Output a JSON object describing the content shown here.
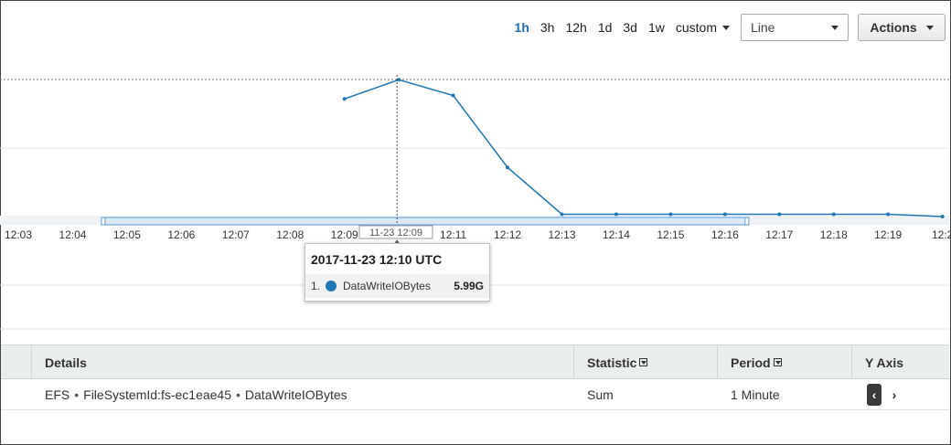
{
  "toolbar": {
    "ranges": [
      "1h",
      "3h",
      "12h",
      "1d",
      "3d",
      "1w"
    ],
    "active_range": "1h",
    "custom_label": "custom",
    "graph_type": "Line",
    "actions_label": "Actions"
  },
  "chart_data": {
    "type": "line",
    "x_tick_labels": [
      "12:03",
      "12:04",
      "12:05",
      "12:06",
      "12:07",
      "12:08",
      "12:09",
      "12:10",
      "12:11",
      "12:12",
      "12:13",
      "12:14",
      "12:15",
      "12:16",
      "12:17",
      "12:18",
      "12:19",
      "12:2"
    ],
    "series": [
      {
        "name": "DataWriteIOBytes",
        "color": "#1f77b4",
        "x": [
          "12:09",
          "12:10",
          "12:11",
          "12:12",
          "12:13",
          "12:14",
          "12:15",
          "12:16",
          "12:17",
          "12:18",
          "12:19",
          "12:20"
        ],
        "values": [
          5.15,
          5.99,
          5.3,
          2.15,
          0.1,
          0.1,
          0.1,
          0.1,
          0.1,
          0.1,
          0.1,
          0.0
        ]
      }
    ],
    "y_unit": "G",
    "ylim": [
      0,
      6
    ],
    "cursor_label": "11-23 12:09",
    "selection_range": [
      "12:05",
      "12:16"
    ]
  },
  "tooltip": {
    "title": "2017-11-23 12:10 UTC",
    "index": "1.",
    "series_name": "DataWriteIOBytes",
    "value": "5.99G"
  },
  "table": {
    "headers": {
      "details": "Details",
      "statistic": "Statistic",
      "period": "Period",
      "yaxis": "Y Axis"
    },
    "row": {
      "namespace": "EFS",
      "dimension": "FileSystemId:fs-ec1eae45",
      "metric": "DataWriteIOBytes",
      "statistic": "Sum",
      "period": "1 Minute",
      "y_left": "‹",
      "y_right": "›"
    }
  }
}
